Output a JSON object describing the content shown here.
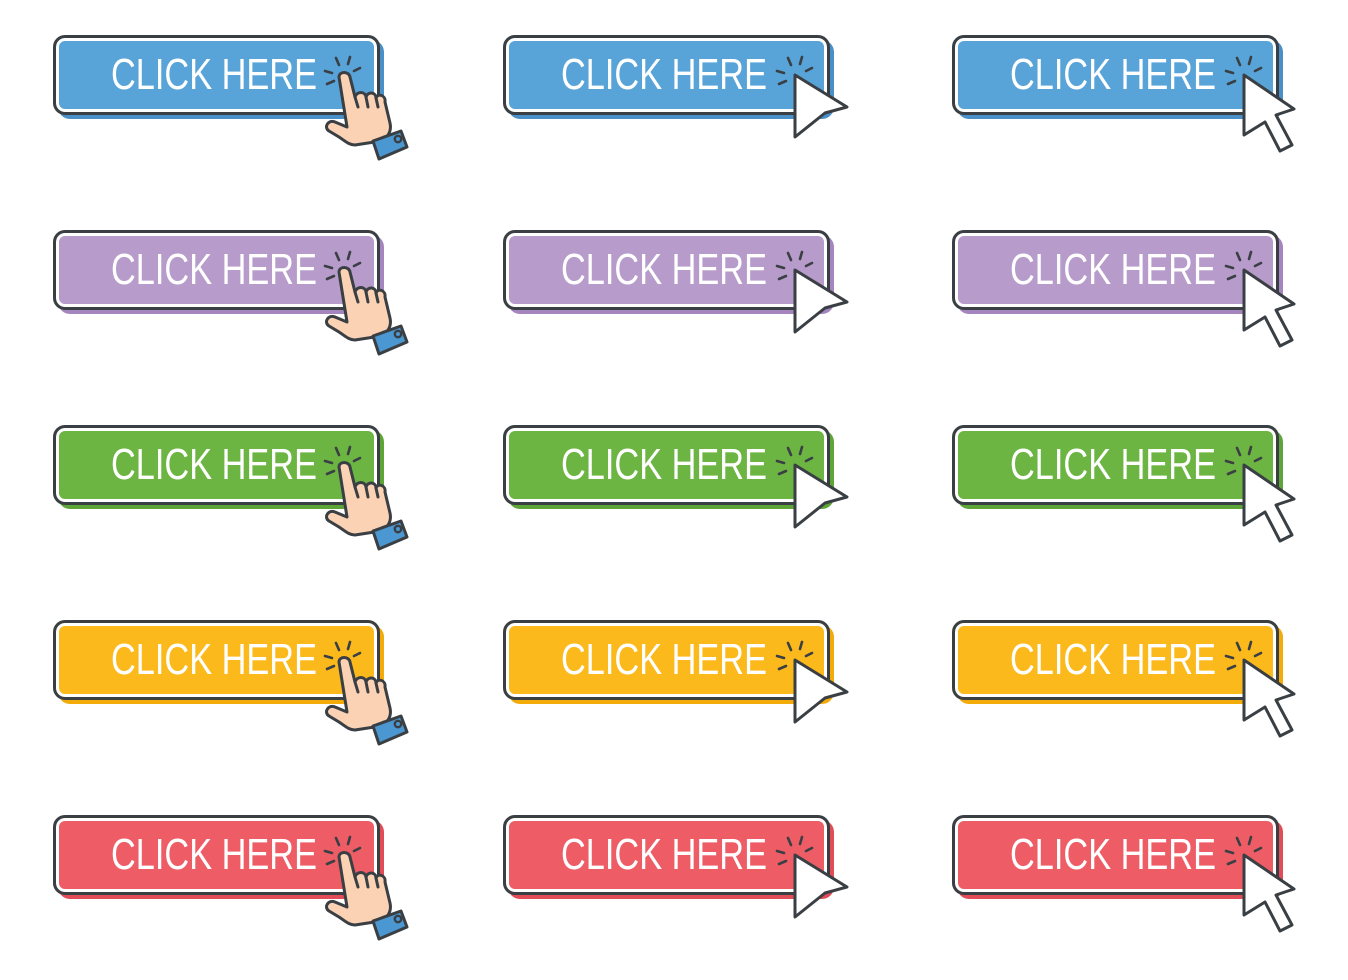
{
  "button_label": "CLICK HERE",
  "cursor_styles": [
    {
      "name": "hand-pointer",
      "icon": "hand-pointer-icon"
    },
    {
      "name": "arrow-head",
      "icon": "arrow-head-cursor-icon"
    },
    {
      "name": "arrow-pointer",
      "icon": "arrow-pointer-cursor-icon"
    }
  ],
  "colors": {
    "outline": "#3a3f44",
    "skin": "#fbd2b4",
    "cuff": "#4a97d1",
    "cursor_fill": "#ffffff"
  },
  "rows": [
    {
      "name": "blue",
      "fill": "#58a3d8",
      "shadow": "#4a90c8"
    },
    {
      "name": "purple",
      "fill": "#b79bcb",
      "shadow": "#a585bd"
    },
    {
      "name": "green",
      "fill": "#6db543",
      "shadow": "#5ea538"
    },
    {
      "name": "yellow",
      "fill": "#fbb91c",
      "shadow": "#f3ab0a"
    },
    {
      "name": "red",
      "fill": "#ee5d66",
      "shadow": "#e24c57"
    }
  ],
  "buttons": [
    {
      "label": "CLICK HERE",
      "row": 0,
      "cursor": 0
    },
    {
      "label": "CLICK HERE",
      "row": 0,
      "cursor": 1
    },
    {
      "label": "CLICK HERE",
      "row": 0,
      "cursor": 2
    },
    {
      "label": "CLICK HERE",
      "row": 1,
      "cursor": 0
    },
    {
      "label": "CLICK HERE",
      "row": 1,
      "cursor": 1
    },
    {
      "label": "CLICK HERE",
      "row": 1,
      "cursor": 2
    },
    {
      "label": "CLICK HERE",
      "row": 2,
      "cursor": 0
    },
    {
      "label": "CLICK HERE",
      "row": 2,
      "cursor": 1
    },
    {
      "label": "CLICK HERE",
      "row": 2,
      "cursor": 2
    },
    {
      "label": "CLICK HERE",
      "row": 3,
      "cursor": 0
    },
    {
      "label": "CLICK HERE",
      "row": 3,
      "cursor": 1
    },
    {
      "label": "CLICK HERE",
      "row": 3,
      "cursor": 2
    },
    {
      "label": "CLICK HERE",
      "row": 4,
      "cursor": 0
    },
    {
      "label": "CLICK HERE",
      "row": 4,
      "cursor": 1
    },
    {
      "label": "CLICK HERE",
      "row": 4,
      "cursor": 2
    }
  ]
}
